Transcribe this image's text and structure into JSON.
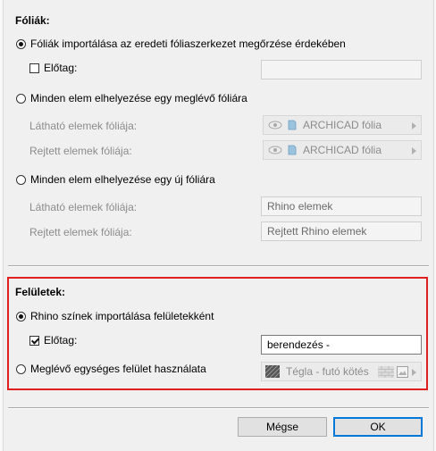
{
  "layers_section": {
    "title": "Fóliák:",
    "option_import_label": "Fóliák importálása az eredeti fóliaszerkezet megőrzése érdekében",
    "prefix_label": "Előtag:",
    "prefix_value": "",
    "option_existing_label": "Minden elem elhelyezése egy meglévő fóliára",
    "visible_layer_label": "Látható elemek fóliája:",
    "hidden_layer_label": "Rejtett elemek fóliája:",
    "visible_layer_value": "ARCHICAD fólia",
    "hidden_layer_value": "ARCHICAD fólia",
    "option_new_label": "Minden elem elhelyezése egy új fóliára",
    "new_visible_label": "Látható elemek fóliája:",
    "new_hidden_label": "Rejtett elemek fóliája:",
    "new_visible_value": "Rhino elemek",
    "new_hidden_value": "Rejtett Rhino elemek"
  },
  "surfaces_section": {
    "title": "Felületek:",
    "option_import_label": "Rhino színek importálása felületekként",
    "prefix_label": "Előtag:",
    "prefix_value": "berendezés -",
    "option_existing_label": "Meglévő egységes felület használata",
    "surface_value": "Tégla - futó kötés"
  },
  "buttons": {
    "cancel": "Mégse",
    "ok": "OK"
  },
  "colors": {
    "highlight_border": "#e02020",
    "default_button_border": "#0078d7"
  }
}
